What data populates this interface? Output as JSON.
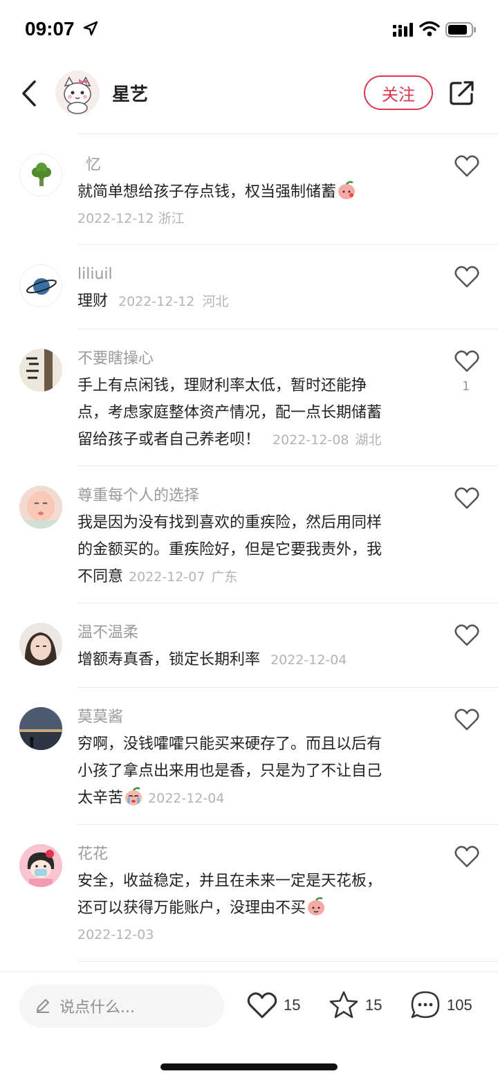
{
  "status_bar": {
    "time": "09:07"
  },
  "header": {
    "author": "星艺",
    "follow_label": "关注"
  },
  "comments": [
    {
      "name": "忆",
      "text": "就简单想给孩子存点钱，权当强制储蓄",
      "date": "2022-12-12",
      "location": "浙江",
      "emoji": "peach-face-icon",
      "likes": ""
    },
    {
      "name": "liliuil",
      "text": "理财",
      "date": "2022-12-12",
      "location": "河北",
      "likes": ""
    },
    {
      "name": "不要瞎操心",
      "text_lines": [
        "手上有点闲钱，理财利率太低，暂时还能挣",
        "点，考虑家庭整体资产情况，配一点长期储蓄",
        "留给孩子或者自己养老呗！"
      ],
      "date": "2022-12-08",
      "location": "湖北",
      "likes": "1"
    },
    {
      "name": "尊重每个人的选择",
      "text_lines": [
        "我是因为没有找到喜欢的重疾险，然后用同样",
        "的金额买的。重疾险好，但是它要我责外，我",
        "不同意"
      ],
      "date": "2022-12-07",
      "location": "广东",
      "likes": ""
    },
    {
      "name": "温不温柔",
      "text": "增额寿真香，锁定长期利率",
      "date": "2022-12-04",
      "location": "",
      "likes": ""
    },
    {
      "name": "莫莫酱",
      "text_lines": [
        "穷啊，没钱嚯嚯只能买来硬存了。而且以后有",
        "小孩了拿点出来用也是香，只是为了不让自己",
        "太辛苦"
      ],
      "date": "2022-12-04",
      "location": "",
      "emoji": "crying-face-icon",
      "likes": ""
    },
    {
      "name": "花花",
      "text_lines": [
        "安全，收益稳定，并且在未来一定是天花板，",
        "还可以获得万能账户，没理由不买"
      ],
      "date": "2022-12-03",
      "location": "",
      "emoji": "peach-face-icon",
      "likes": ""
    }
  ],
  "bottom_bar": {
    "input_placeholder": "说点什么...",
    "like_count": "15",
    "star_count": "15",
    "comment_count": "105"
  },
  "colors": {
    "accent": "#e0344f",
    "meta": "#b3b3b3",
    "name": "#9b9b9b"
  }
}
